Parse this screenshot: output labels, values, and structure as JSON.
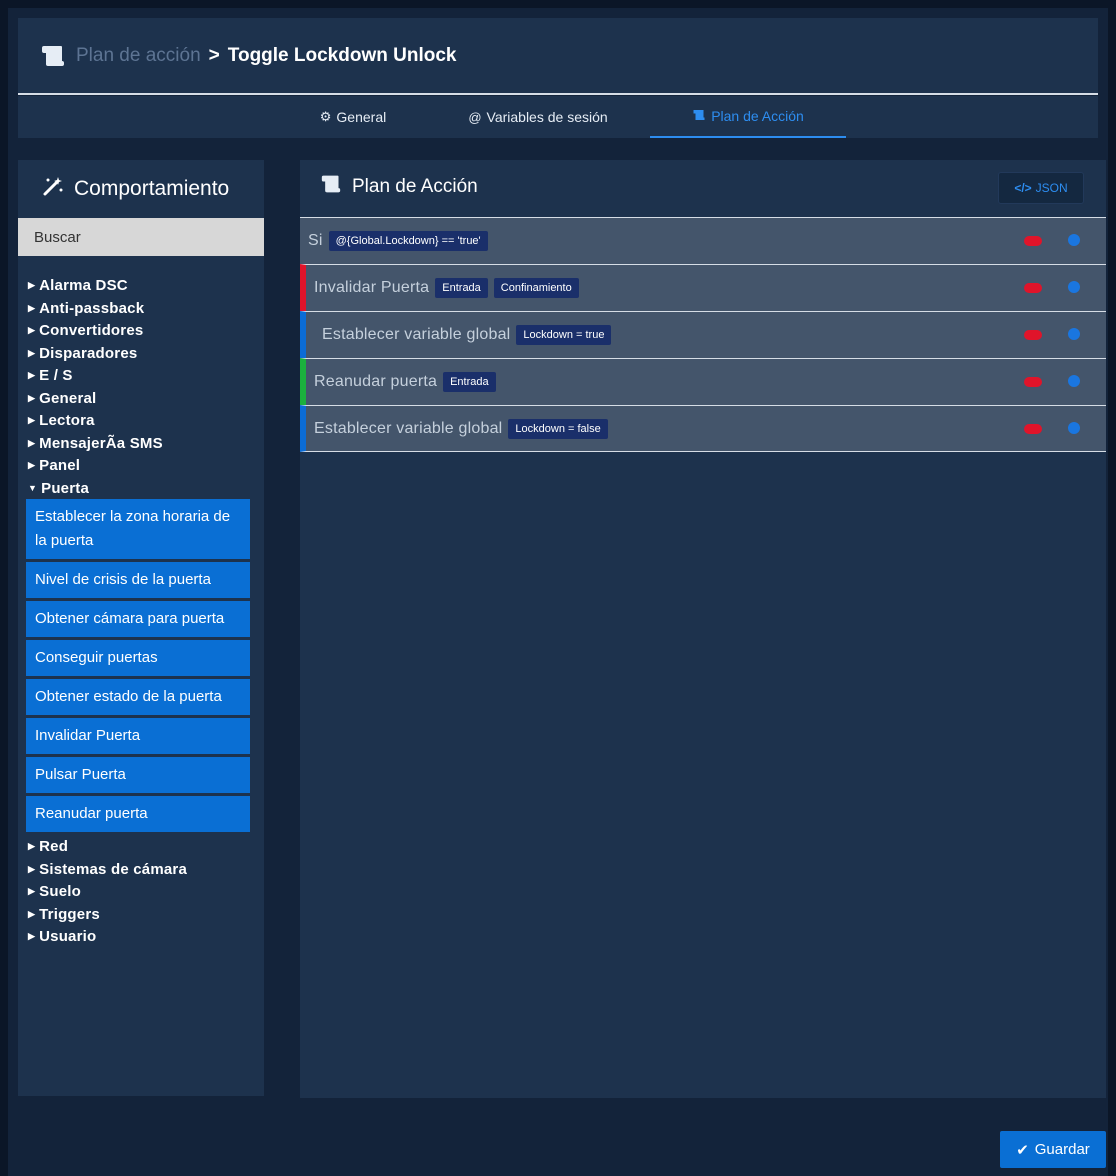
{
  "header": {
    "breadcrumb_parent": "Plan de acción",
    "separator": ">",
    "title": "Toggle Lockdown Unlock",
    "icon": "scroll-icon"
  },
  "tabs": [
    {
      "label": "General",
      "icon": "gear-icon",
      "active": false
    },
    {
      "label": "Variables de sesión",
      "icon": "at-icon",
      "active": false
    },
    {
      "label": "Plan de Acción",
      "icon": "scroll-icon",
      "active": true
    }
  ],
  "sidebar": {
    "title": "Comportamiento",
    "title_icon": "magic-wand-icon",
    "search_placeholder": "Buscar",
    "categories_before": [
      "Alarma DSC",
      "Anti-passback",
      "Convertidores",
      "Disparadores",
      "E / S",
      "General",
      "Lectora",
      "MensajerÃa SMS",
      "Panel"
    ],
    "expanded_category": "Puerta",
    "expanded_items": [
      "Establecer la zona horaria de la puerta",
      "Nivel de crisis de la puerta",
      "Obtener cámara para puerta",
      "Conseguir puertas",
      "Obtener estado de la puerta",
      "Invalidar Puerta",
      "Pulsar Puerta",
      "Reanudar puerta"
    ],
    "categories_after": [
      "Red",
      "Sistemas de cámara",
      "Suelo",
      "Triggers",
      "Usuario"
    ]
  },
  "plan": {
    "title": "Plan de Acción",
    "json_button": "JSON",
    "rows": [
      {
        "label": "Si",
        "chips": [
          "@{Global.Lockdown} == 'true'"
        ],
        "bar": "none"
      },
      {
        "label": "Invalidar Puerta",
        "chips": [
          "Entrada",
          "Confinamiento"
        ],
        "bar": "red"
      },
      {
        "label": "Establecer variable global",
        "chips": [
          "Lockdown = true"
        ],
        "bar": "blue"
      },
      {
        "label": "Reanudar puerta",
        "chips": [
          "Entrada"
        ],
        "bar": "green"
      },
      {
        "label": "Establecer variable global",
        "chips": [
          "Lockdown = false"
        ],
        "bar": "blue"
      }
    ]
  },
  "save_button": "Guardar",
  "colors": {
    "accent": "#0a6fd4",
    "delete": "#e0142a",
    "bar_green": "#1bb03d",
    "panel": "#1d324d",
    "background": "#0b1627"
  }
}
